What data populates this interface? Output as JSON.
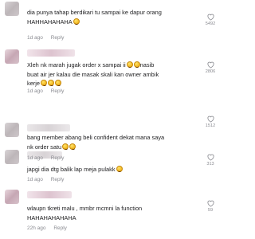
{
  "comments": [
    {
      "text": "dia punya tahap berdikari tu sampai ke dapur orang",
      "text2": "HAHHAHAHAHA",
      "date": "1d ago",
      "reply": "Reply",
      "likes": "5492"
    },
    {
      "text": "Xleh nk marah jugak order x sampai ii",
      "text_b": "nasib",
      "text2": "buat air jer kalau die masak skali kan owner ambik",
      "text3": "kerje",
      "date": "1d ago",
      "reply": "Reply",
      "likes": "2806"
    },
    {
      "text": "bang member abang beli confident dekat mana saya",
      "text2": "nk order satu",
      "date": "1d ago",
      "reply": "Reply",
      "likes": "1512"
    },
    {
      "text": "japgi dia dtg balik lap meja pulakk",
      "date": "1d ago",
      "reply": "Reply",
      "likes": "313"
    },
    {
      "text": "wlaupn tkreti malu , mmbr mcmni la function",
      "text2": "HAHAHAHAHAHA",
      "date": "22h ago",
      "reply": "Reply",
      "likes": "59"
    }
  ],
  "icons": {
    "like": "heart-outline-icon",
    "emoji": "laughing-face-emoji"
  },
  "colors": {
    "text": "#161823",
    "meta": "#8a8b91",
    "background": "#ffffff"
  }
}
